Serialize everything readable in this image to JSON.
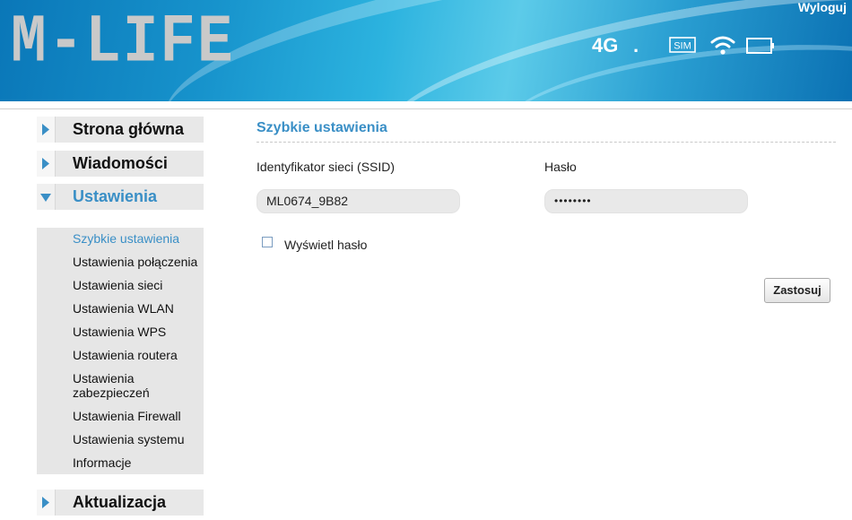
{
  "header": {
    "logo_text": "M-LIFE",
    "logout_label": "Wyloguj",
    "network_type": "4G",
    "signal_indicator": ".",
    "sim_label": "SIM",
    "icons": [
      "sim-icon",
      "wifi-icon",
      "battery-icon"
    ]
  },
  "sidebar": {
    "items": [
      {
        "label": "Strona główna",
        "expanded": false
      },
      {
        "label": "Wiadomości",
        "expanded": false
      },
      {
        "label": "Ustawienia",
        "expanded": true
      },
      {
        "label": "Aktualizacja",
        "expanded": false
      }
    ],
    "submenu": [
      {
        "label": "Szybkie ustawienia",
        "active": true
      },
      {
        "label": "Ustawienia połączenia"
      },
      {
        "label": "Ustawienia sieci"
      },
      {
        "label": "Ustawienia WLAN"
      },
      {
        "label": "Ustawienia WPS"
      },
      {
        "label": "Ustawienia routera"
      },
      {
        "label": "Ustawienia zabezpieczeń"
      },
      {
        "label": "Ustawienia Firewall"
      },
      {
        "label": "Ustawienia systemu"
      },
      {
        "label": "Informacje"
      }
    ]
  },
  "main": {
    "section_title": "Szybkie ustawienia",
    "ssid_label": "Identyfikator sieci (SSID)",
    "ssid_value": "ML0674_9B82",
    "password_label": "Hasło",
    "password_value": "••••••••",
    "show_password_label": "Wyświetl hasło",
    "show_password_checked": false,
    "apply_label": "Zastosuj"
  },
  "colors": {
    "accent": "#3a8fc6",
    "header_blue": "#1793cc",
    "sidebar_bg": "#e8e8e8"
  }
}
